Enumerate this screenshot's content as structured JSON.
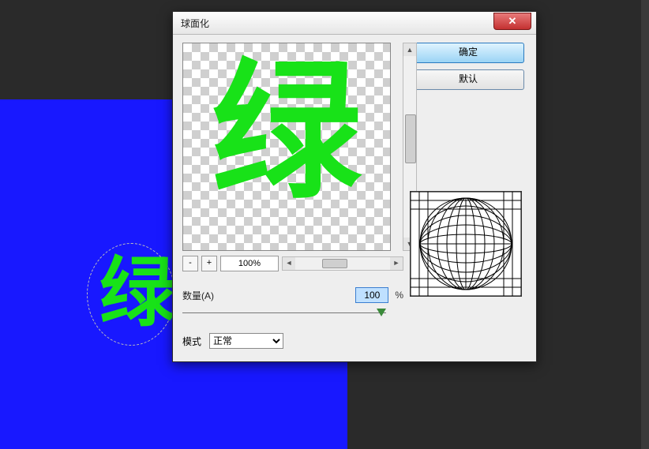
{
  "dialog": {
    "title": "球面化",
    "ok_label": "确定",
    "default_label": "默认",
    "zoom_minus": "-",
    "zoom_plus": "+",
    "zoom_value": "100%",
    "amount_label": "数量(A)",
    "amount_value": "100",
    "amount_unit": "%",
    "mode_label": "模式",
    "mode_value": "正常",
    "close_glyph": "✕"
  },
  "canvas": {
    "char": "绿",
    "preview_char": "绿"
  },
  "colors": {
    "canvas_bg": "#1818ff",
    "brush_green": "#18e218",
    "arrow_red": "#d40000"
  }
}
